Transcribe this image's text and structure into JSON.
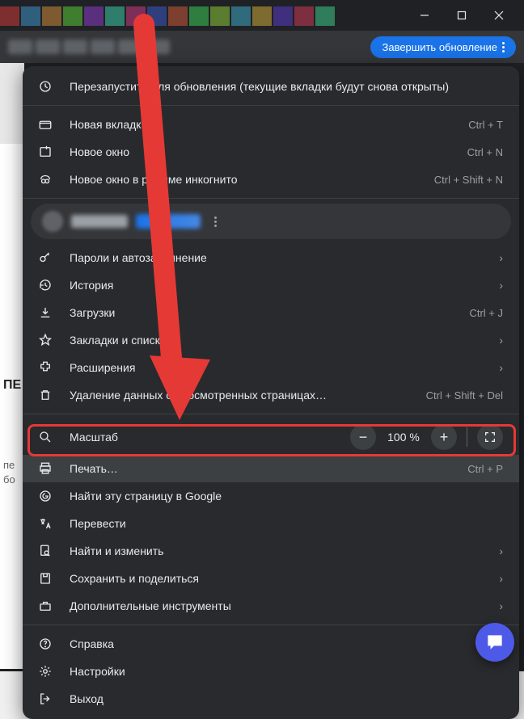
{
  "titlebar": {
    "minimize_tip": "Свернуть",
    "maximize_tip": "Развернуть",
    "close_tip": "Закрыть"
  },
  "toolbar": {
    "update_label": "Завершить обновление"
  },
  "page_bg": {
    "t1": "ПЕ",
    "t2": "пе",
    "t3": "бо"
  },
  "menu": {
    "restart": "Перезапустите для обновления (текущие вкладки будут снова открыты)",
    "new_tab": {
      "label": "Новая вкладка",
      "shortcut": "Ctrl + T"
    },
    "new_window": {
      "label": "Новое окно",
      "shortcut": "Ctrl + N"
    },
    "incognito": {
      "label": "Новое окно в режиме инкогнито",
      "shortcut": "Ctrl + Shift + N"
    },
    "passwords": {
      "label": "Пароли и автозаполнение"
    },
    "history": {
      "label": "История"
    },
    "downloads": {
      "label": "Загрузки",
      "shortcut": "Ctrl + J"
    },
    "bookmarks": {
      "label": "Закладки и списки"
    },
    "extensions": {
      "label": "Расширения"
    },
    "clear_data": {
      "label": "Удаление данных о просмотренных страницах…",
      "shortcut": "Ctrl + Shift + Del"
    },
    "zoom": {
      "label": "Масштаб",
      "value": "100 %"
    },
    "print": {
      "label": "Печать…",
      "shortcut": "Ctrl + P"
    },
    "find_google": {
      "label": "Найти эту страницу в Google"
    },
    "translate": {
      "label": "Перевести"
    },
    "find_edit": {
      "label": "Найти и изменить"
    },
    "save_share": {
      "label": "Сохранить и поделиться"
    },
    "more_tools": {
      "label": "Дополнительные инструменты"
    },
    "help": {
      "label": "Справка"
    },
    "settings": {
      "label": "Настройки"
    },
    "exit": {
      "label": "Выход"
    }
  }
}
